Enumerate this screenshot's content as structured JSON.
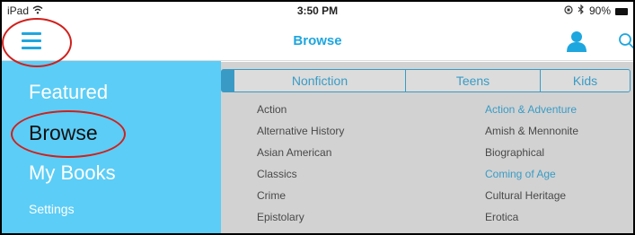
{
  "status_bar": {
    "device": "iPad",
    "time": "3:50 PM",
    "battery": "90%"
  },
  "nav": {
    "title": "Browse",
    "menu_icon": "hamburger-icon",
    "user_icon": "user-icon",
    "search_icon": "search-icon"
  },
  "side_menu": {
    "items": [
      {
        "label": "Featured",
        "selected": false
      },
      {
        "label": "Browse",
        "selected": true
      },
      {
        "label": "My Books",
        "selected": false
      },
      {
        "label": "Settings",
        "selected": false
      }
    ]
  },
  "tabs": [
    {
      "label": "Nonfiction"
    },
    {
      "label": "Teens"
    },
    {
      "label": "Kids"
    }
  ],
  "genres": {
    "left": [
      "Action",
      "Alternative History",
      "Asian American",
      "Classics",
      "Crime",
      "Epistolary"
    ],
    "right": [
      "Action & Adventure",
      "Amish & Mennonite",
      "Biographical",
      "Coming of Age",
      "Cultural Heritage",
      "Erotica"
    ]
  },
  "colors": {
    "accent": "#1ea6df",
    "side_menu_bg": "#5ccdf6",
    "annotation": "#d0201c"
  }
}
